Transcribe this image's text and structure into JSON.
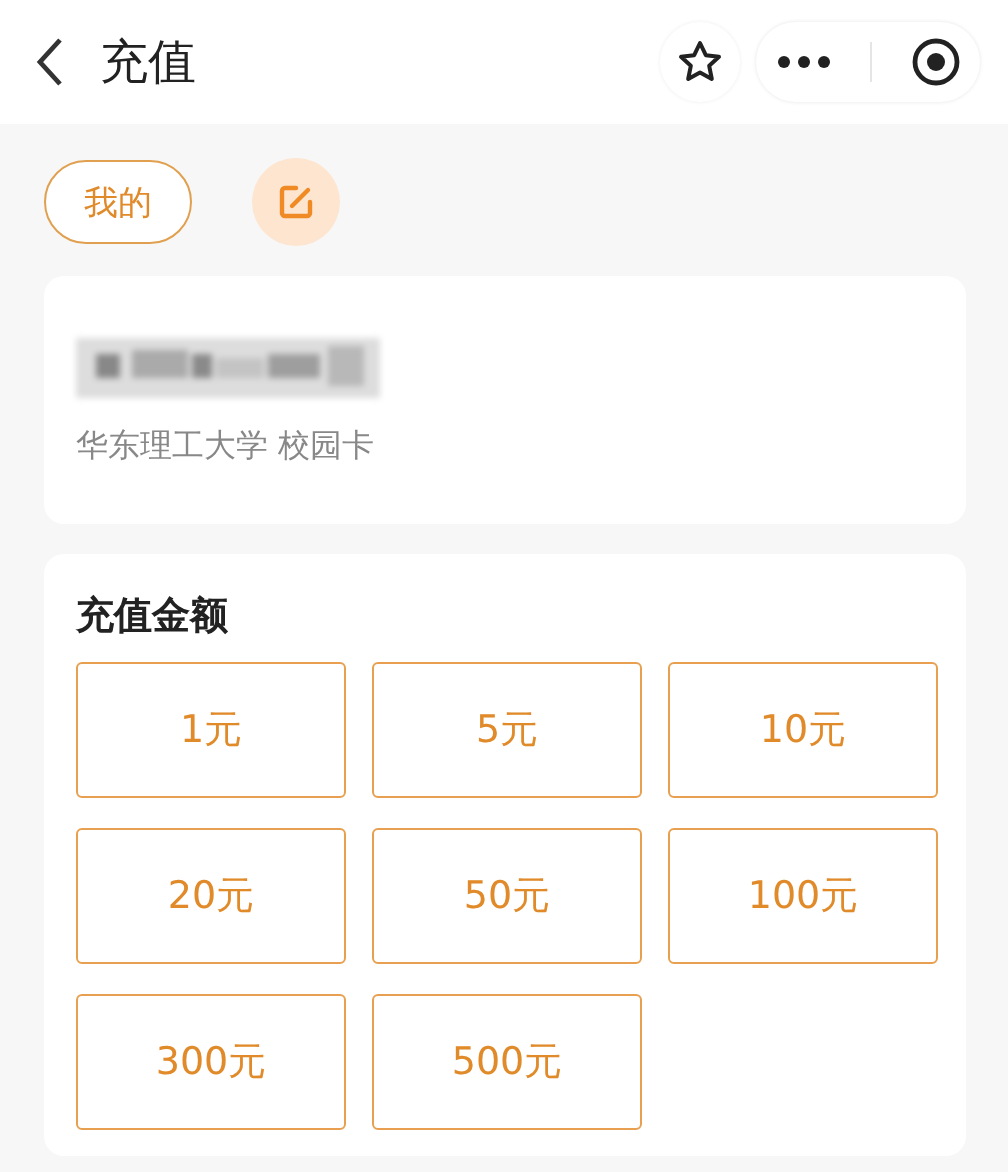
{
  "header": {
    "title": "充值"
  },
  "tabs": [
    {
      "label": "我的",
      "selected": true
    }
  ],
  "card": {
    "subtitle": "华东理工大学 校园卡"
  },
  "recharge": {
    "title": "充值金额",
    "amounts": [
      {
        "label": "1元",
        "selected": false
      },
      {
        "label": "5元",
        "selected": false
      },
      {
        "label": "10元",
        "selected": false
      },
      {
        "label": "20元",
        "selected": false
      },
      {
        "label": "50元",
        "selected": false
      },
      {
        "label": "100元",
        "selected": false
      },
      {
        "label": "300元",
        "selected": false
      },
      {
        "label": "500元",
        "selected": false
      }
    ]
  }
}
